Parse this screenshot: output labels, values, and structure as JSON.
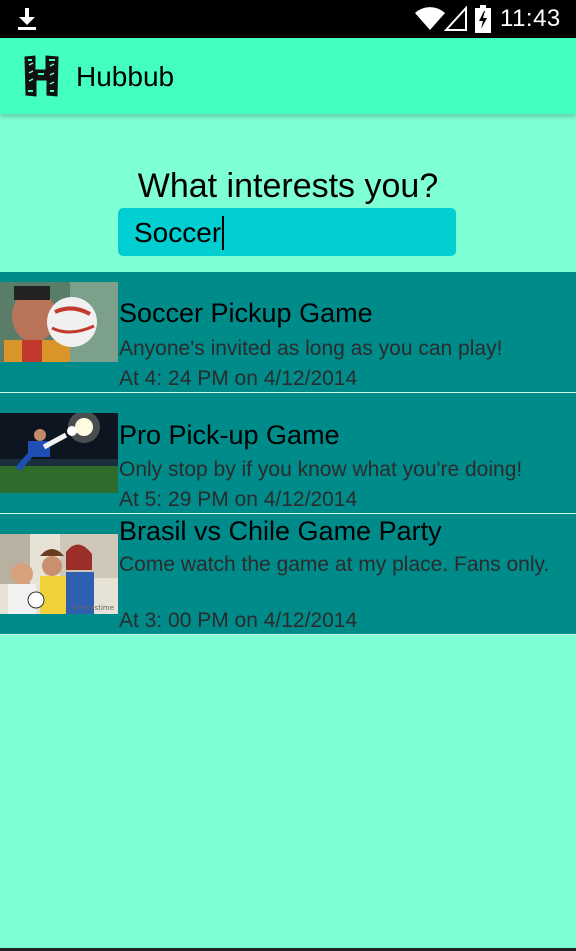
{
  "status_bar": {
    "time": "11:43",
    "icons": [
      "download-icon",
      "wifi-icon",
      "signal-icon",
      "battery-charging-icon"
    ]
  },
  "action_bar": {
    "app_icon": "hubbub-logo",
    "title": "Hubbub"
  },
  "search": {
    "prompt": "What interests you?",
    "value": "Soccer"
  },
  "events": [
    {
      "title": "Soccer Pickup Game",
      "description": "Anyone's invited as long as you can play!",
      "time": "At 4: 24 PM on 4/12/2014",
      "thumbnail": "player-heading-ball-photo"
    },
    {
      "title": "Pro Pick-up Game",
      "description": "Only stop by if you know what you're doing!",
      "time": "At 5: 29 PM on 4/12/2014",
      "thumbnail": "stadium-bicycle-kick-photo"
    },
    {
      "title": "Brasil vs Chile Game Party",
      "description": "Come watch the game at my place. Fans only.",
      "time": "At 3: 00 PM on 4/12/2014",
      "thumbnail": "fans-watching-tv-photo"
    }
  ],
  "colors": {
    "background": "#7fffd4",
    "action_bar": "#43ffc0",
    "search_field": "#00ced1",
    "list_row": "#008b8b"
  }
}
